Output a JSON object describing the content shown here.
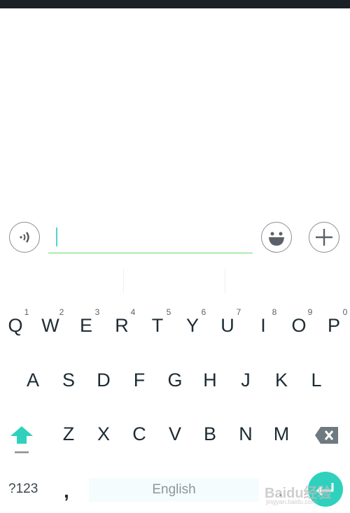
{
  "input": {
    "value": ""
  },
  "keyboard": {
    "row1": [
      {
        "k": "Q",
        "h": "1"
      },
      {
        "k": "W",
        "h": "2"
      },
      {
        "k": "E",
        "h": "3"
      },
      {
        "k": "R",
        "h": "4"
      },
      {
        "k": "T",
        "h": "5"
      },
      {
        "k": "Y",
        "h": "6"
      },
      {
        "k": "U",
        "h": "7"
      },
      {
        "k": "I",
        "h": "8"
      },
      {
        "k": "O",
        "h": "9"
      },
      {
        "k": "P",
        "h": "0"
      }
    ],
    "row2": [
      "A",
      "S",
      "D",
      "F",
      "G",
      "H",
      "J",
      "K",
      "L"
    ],
    "row3": [
      "Z",
      "X",
      "C",
      "V",
      "B",
      "N",
      "M"
    ],
    "symbols_label": "?123",
    "comma": ",",
    "space_label": "English",
    "period": "."
  },
  "colors": {
    "accent": "#2fd1bd",
    "input_underline": "#6ad56a",
    "key_text": "#1d2b33"
  },
  "icons": {
    "voice": "voice-icon",
    "emoji": "emoji-icon",
    "plus": "plus-icon",
    "shift": "shift-icon",
    "backspace": "backspace-icon",
    "enter": "enter-icon"
  },
  "watermark": {
    "text": "Baidu经验",
    "sub": "jingyan.baidu.com"
  }
}
